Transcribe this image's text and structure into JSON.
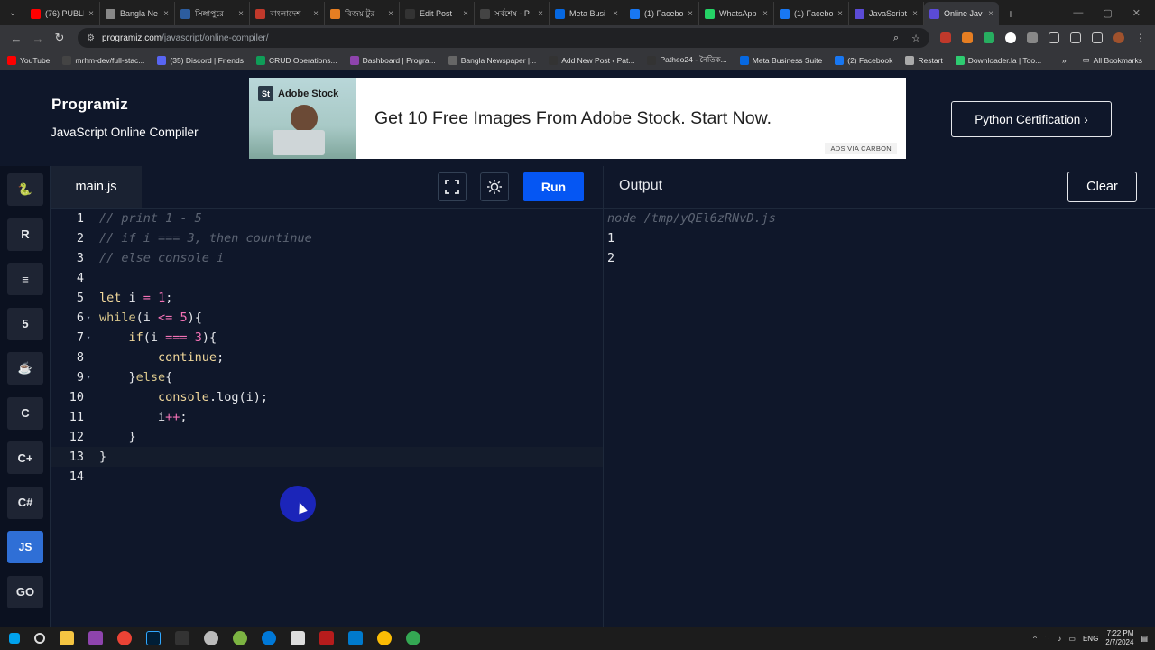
{
  "browser": {
    "tabs": [
      {
        "title": "(76) PUBLI",
        "color": "#ff0000",
        "active": false
      },
      {
        "title": "Bangla Ne",
        "color": "#888888",
        "active": false
      },
      {
        "title": "সিঙ্গাপুরে",
        "color": "#2d5d9f",
        "active": false
      },
      {
        "title": "বাংলাদেশ",
        "color": "#c0392b",
        "active": false
      },
      {
        "title": "বিজয় টুর",
        "color": "#e67e22",
        "active": false
      },
      {
        "title": "Edit Post",
        "color": "#333333",
        "active": false
      },
      {
        "title": "সর্বশেষ - P",
        "color": "#444444",
        "active": false
      },
      {
        "title": "Meta Busi",
        "color": "#0668e1",
        "active": false
      },
      {
        "title": "(1) Facebo",
        "color": "#1877f2",
        "active": false
      },
      {
        "title": "WhatsApp",
        "color": "#25d366",
        "active": false
      },
      {
        "title": "(1) Facebo",
        "color": "#1877f2",
        "active": false
      },
      {
        "title": "JavaScript",
        "color": "#5b4bd6",
        "active": false
      },
      {
        "title": "Online Jav",
        "color": "#5b4bd6",
        "active": true
      }
    ],
    "url_host": "programiz.com",
    "url_path": "/javascript/online-compiler/",
    "bookmarks": [
      {
        "label": "YouTube",
        "color": "#ff0000"
      },
      {
        "label": "mrhm-dev/full-stac...",
        "color": "#444444"
      },
      {
        "label": "(35) Discord | Friends",
        "color": "#5865f2"
      },
      {
        "label": "CRUD Operations...",
        "color": "#0f9d58"
      },
      {
        "label": "Dashboard | Progra...",
        "color": "#8e44ad"
      },
      {
        "label": "Bangla Newspaper |...",
        "color": "#666666"
      },
      {
        "label": "Add New Post ‹ Pat...",
        "color": "#333333"
      },
      {
        "label": "Patheo24 - নৈতিক...",
        "color": "#333333"
      },
      {
        "label": "Meta Business Suite",
        "color": "#0668e1"
      },
      {
        "label": "(2) Facebook",
        "color": "#1877f2"
      },
      {
        "label": "Restart",
        "color": "#aaaaaa"
      },
      {
        "label": "Downloader.la | Too...",
        "color": "#2ecc71"
      }
    ],
    "all_bookmarks": "All Bookmarks"
  },
  "header": {
    "logo": "Programiz",
    "subtitle": "JavaScript Online Compiler",
    "ad_brand": "Adobe Stock",
    "ad_badge": "St",
    "ad_text": "Get 10 Free Images From Adobe Stock. Start Now.",
    "ad_footer": "ADS VIA CARBON",
    "cert_button": "Python Certification"
  },
  "rail": {
    "languages": [
      {
        "name": "python",
        "glyph": "🐍",
        "active": false
      },
      {
        "name": "r",
        "glyph": "R",
        "active": false
      },
      {
        "name": "sql",
        "glyph": "≡",
        "active": false
      },
      {
        "name": "html",
        "glyph": "5",
        "active": false
      },
      {
        "name": "java",
        "glyph": "☕",
        "active": false
      },
      {
        "name": "c",
        "glyph": "C",
        "active": false
      },
      {
        "name": "cpp",
        "glyph": "C+",
        "active": false
      },
      {
        "name": "csharp",
        "glyph": "C#",
        "active": false
      },
      {
        "name": "js",
        "glyph": "JS",
        "active": true
      },
      {
        "name": "go",
        "glyph": "GO",
        "active": false
      }
    ]
  },
  "editor": {
    "file_name": "main.js",
    "run_label": "Run",
    "lines": [
      {
        "n": "1",
        "fold": "",
        "tokens": [
          [
            "cm",
            "// print 1 - 5"
          ]
        ]
      },
      {
        "n": "2",
        "fold": "",
        "tokens": [
          [
            "cm",
            "// if i === 3, then countinue"
          ]
        ]
      },
      {
        "n": "3",
        "fold": "",
        "tokens": [
          [
            "cm",
            "// else console i"
          ]
        ]
      },
      {
        "n": "4",
        "fold": "",
        "tokens": []
      },
      {
        "n": "5",
        "fold": "",
        "tokens": [
          [
            "ctl",
            "let"
          ],
          [
            "pl",
            " i "
          ],
          [
            "op",
            "="
          ],
          [
            "pl",
            " "
          ],
          [
            "num",
            "1"
          ],
          [
            "pl",
            ";"
          ]
        ]
      },
      {
        "n": "6",
        "fold": "▾",
        "tokens": [
          [
            "kw",
            "while"
          ],
          [
            "pl",
            "(i "
          ],
          [
            "op",
            "<="
          ],
          [
            "pl",
            " "
          ],
          [
            "num",
            "5"
          ],
          [
            "pl",
            "){"
          ]
        ]
      },
      {
        "n": "7",
        "fold": "▾",
        "tokens": [
          [
            "pl",
            "    "
          ],
          [
            "ctl",
            "if"
          ],
          [
            "pl",
            "(i "
          ],
          [
            "op",
            "==="
          ],
          [
            "pl",
            " "
          ],
          [
            "num",
            "3"
          ],
          [
            "pl",
            "){"
          ]
        ]
      },
      {
        "n": "8",
        "fold": "",
        "tokens": [
          [
            "pl",
            "        "
          ],
          [
            "ctl",
            "continue"
          ],
          [
            "pl",
            ";"
          ]
        ]
      },
      {
        "n": "9",
        "fold": "▾",
        "tokens": [
          [
            "pl",
            "    }"
          ],
          [
            "kw",
            "else"
          ],
          [
            "pl",
            "{"
          ]
        ]
      },
      {
        "n": "10",
        "fold": "",
        "tokens": [
          [
            "pl",
            "        "
          ],
          [
            "ctl",
            "console"
          ],
          [
            "pl",
            ".log(i);"
          ]
        ]
      },
      {
        "n": "11",
        "fold": "",
        "tokens": [
          [
            "pl",
            "        i"
          ],
          [
            "op",
            "++"
          ],
          [
            "pl",
            ";"
          ]
        ]
      },
      {
        "n": "12",
        "fold": "",
        "tokens": [
          [
            "pl",
            "    }"
          ]
        ]
      },
      {
        "n": "13",
        "fold": "",
        "tokens": [
          [
            "pl",
            "}"
          ]
        ]
      },
      {
        "n": "14",
        "fold": "",
        "tokens": []
      }
    ],
    "highlight_line": "13"
  },
  "output": {
    "label": "Output",
    "clear_label": "Clear",
    "lines": [
      {
        "text": "node /tmp/yQEl6zRNvD.js",
        "cmd": true
      },
      {
        "text": "1",
        "cmd": false
      },
      {
        "text": "2",
        "cmd": false
      }
    ]
  },
  "taskbar": {
    "time": "7:22 PM",
    "date": "2/7/2024",
    "lang": "ENG"
  }
}
